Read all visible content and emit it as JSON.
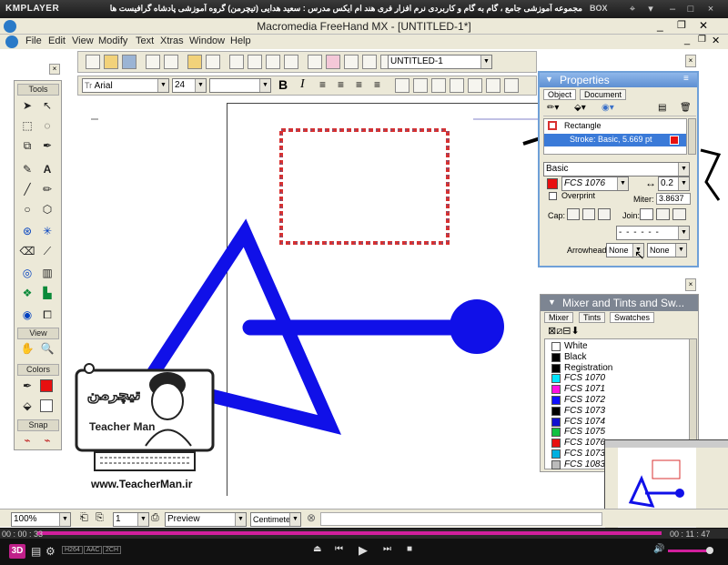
{
  "player": {
    "logo": "KMPLAYER",
    "movie_title": "مجموعه آموزشی جامع ، گام به گام و کاربردی نرم افزار فری هند ام ایکس  مدرس : سعید هدایی (تیچرمن) گروه آموزشی پادشاه گرافیست ها",
    "box_label": "BOX",
    "time_elapsed": "00 : 00 : 33",
    "time_total": "00 : 11 : 47",
    "progress": 0.93,
    "badges": [
      "H264",
      "AAC",
      "2CH"
    ],
    "badge_3d": "3D"
  },
  "app": {
    "title": "Macromedia FreeHand MX - [UNTITLED-1*]",
    "menu": [
      "File",
      "Edit",
      "View",
      "Modify",
      "Text",
      "Xtras",
      "Window",
      "Help"
    ],
    "doc_combo": "UNTITLED-1",
    "font_combo": "Arial",
    "size_combo": "24",
    "bold_glyph": "B",
    "italic_glyph": "I"
  },
  "tools": {
    "title": "Tools",
    "view_title": "View",
    "colors_title": "Colors",
    "snap_title": "Snap"
  },
  "properties": {
    "title": "Properties",
    "tab_object": "Object",
    "tab_document": "Document",
    "row_rectangle": "Rectangle",
    "row_stroke": "Stroke: Basic, 5.669 pt",
    "stroke_type": "Basic",
    "color_name": "FCS 1076",
    "width_value": "0.2",
    "overprint": "Overprint",
    "miter_label": "Miter:",
    "miter_value": "3.8637",
    "cap_label": "Cap:",
    "join_label": "Join:",
    "arrowheads_label": "Arrowheads:",
    "arrow_start": "None",
    "arrow_end": "None"
  },
  "mixer": {
    "title": "Mixer and Tints and Sw...",
    "tab_mixer": "Mixer",
    "tab_tints": "Tints",
    "tab_swatches": "Swatches",
    "swatches": [
      {
        "name": "White",
        "color": "#ffffff"
      },
      {
        "name": "Black",
        "color": "#000000"
      },
      {
        "name": "Registration",
        "color": "#000000"
      },
      {
        "name": "FCS 1070",
        "color": "#00e5ff"
      },
      {
        "name": "FCS 1071",
        "color": "#ff10e0"
      },
      {
        "name": "FCS 1072",
        "color": "#1010ff"
      },
      {
        "name": "FCS 1073",
        "color": "#000000"
      },
      {
        "name": "FCS 1074",
        "color": "#1010d0"
      },
      {
        "name": "FCS 1075",
        "color": "#10c040"
      },
      {
        "name": "FCS 1076",
        "color": "#e81010"
      },
      {
        "name": "FCS 1073",
        "color": "#00b0e0"
      },
      {
        "name": "FCS 1083",
        "color": "#bbbbbb"
      }
    ]
  },
  "status": {
    "zoom": "100%",
    "page": "1",
    "mode": "Preview",
    "units": "Centimeter"
  },
  "watermark": {
    "name": "Teacher Man",
    "url": "www.TeacherMan.ir"
  },
  "colors": {
    "blue_shape": "#1010e8",
    "red_stroke": "#d83030",
    "fill_swatch": "#e81010"
  }
}
